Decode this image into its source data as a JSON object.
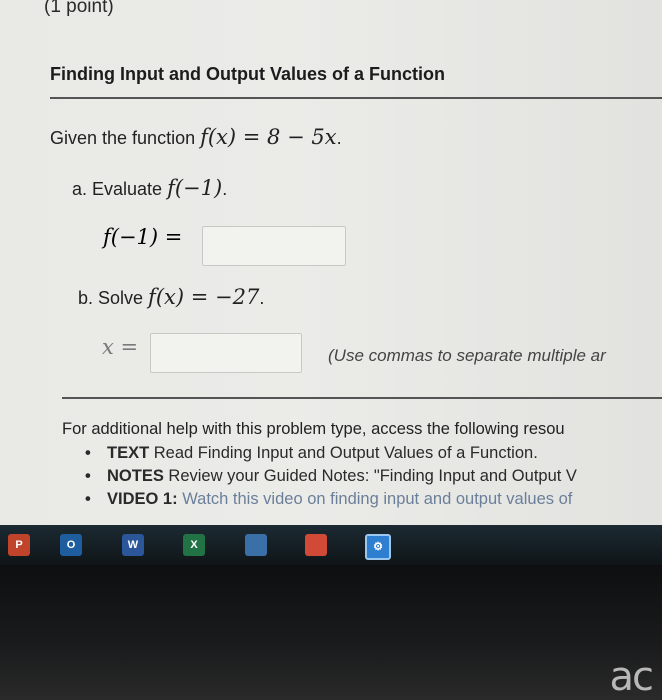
{
  "point_label": "(1 point)",
  "section_title": "Finding Input and Output Values of a Function",
  "given": {
    "prefix": "Given the function ",
    "function": "f(x) = 8 − 5x",
    "suffix": "."
  },
  "part_a": {
    "label": "a. Evaluate ",
    "expr": "f(−1)",
    "suffix": ".",
    "answer_label": "f(−1) =",
    "answer_value": ""
  },
  "part_b": {
    "label": "b. Solve ",
    "expr": "f(x) = −27",
    "suffix": ".",
    "answer_label": "x =",
    "answer_value": "",
    "hint": "(Use commas to separate multiple ar"
  },
  "help": {
    "intro": "For additional help with this problem type, access the following resou",
    "items": [
      {
        "key": "TEXT",
        "text": " Read Finding Input and Output Values of a Function."
      },
      {
        "key": "NOTES",
        "text": " Review your Guided Notes: \"Finding Input and Output V"
      },
      {
        "key": "VIDEO 1:",
        "text": " Watch this video on finding input and output values of"
      }
    ]
  },
  "taskbar": {
    "icons": [
      {
        "name": "powerpoint-icon",
        "label": "P",
        "color": "#c0442b"
      },
      {
        "name": "outlook-icon",
        "label": "O",
        "color": "#1e5e9e"
      },
      {
        "name": "word-icon",
        "label": "W",
        "color": "#2b579a"
      },
      {
        "name": "excel-icon",
        "label": "X",
        "color": "#217346"
      },
      {
        "name": "store-icon",
        "label": "",
        "color": "#3a6fa8"
      },
      {
        "name": "office-icon",
        "label": "",
        "color": "#d04a37"
      },
      {
        "name": "settings-icon",
        "label": "",
        "color": "#2f7fd1"
      }
    ]
  },
  "brand": "ac"
}
